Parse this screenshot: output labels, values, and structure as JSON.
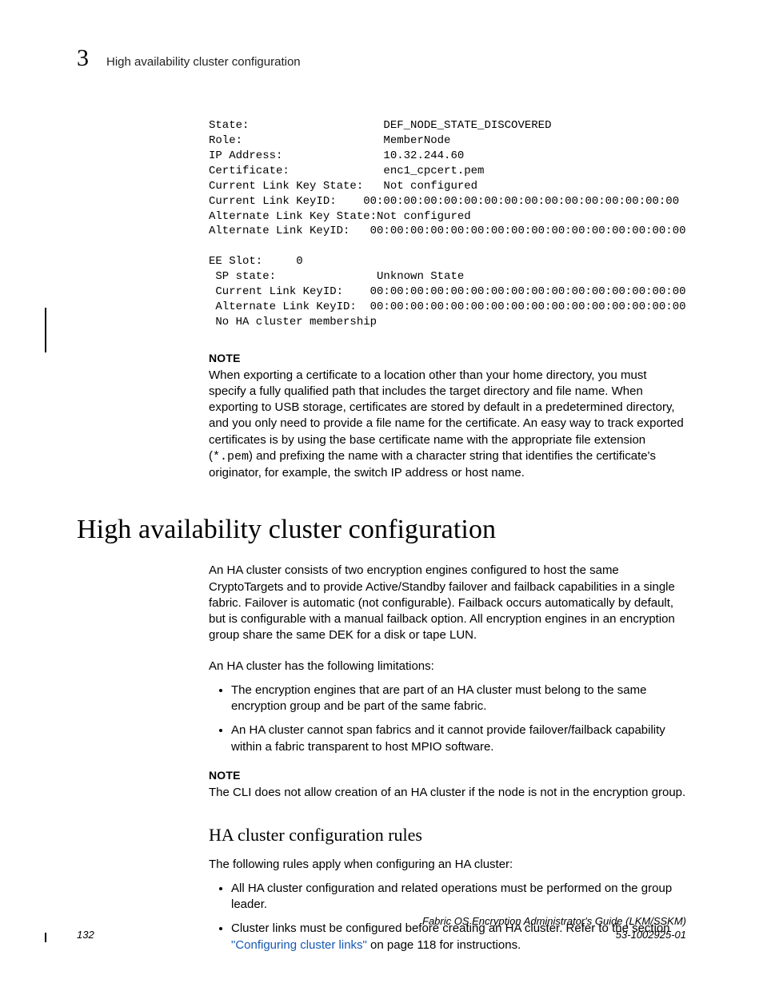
{
  "header": {
    "chapter_number": "3",
    "chapter_title": "High availability cluster configuration"
  },
  "cli_block": "State:                    DEF_NODE_STATE_DISCOVERED\nRole:                     MemberNode\nIP Address:               10.32.244.60\nCertificate:              enc1_cpcert.pem\nCurrent Link Key State:   Not configured\nCurrent Link KeyID:    00:00:00:00:00:00:00:00:00:00:00:00:00:00:00:00\nAlternate Link Key State:Not configured\nAlternate Link KeyID:   00:00:00:00:00:00:00:00:00:00:00:00:00:00:00:00\n\nEE Slot:     0\n SP state:               Unknown State\n Current Link KeyID:    00:00:00:00:00:00:00:00:00:00:00:00:00:00:00:00\n Alternate Link KeyID:  00:00:00:00:00:00:00:00:00:00:00:00:00:00:00:00\n No HA cluster membership",
  "note1": {
    "label": "NOTE",
    "text_before": "When exporting a certificate to a location other than your home directory, you must specify a fully qualified path that includes the target directory and file name. When exporting to USB storage, certificates are stored by default in a predetermined directory, and you only need to provide a file name for the certificate. An easy way to track exported certificates is by using the base certificate name with the appropriate file extension (",
    "mono": "*.pem",
    "text_after": ") and prefixing the name with a character string that identifies the certificate's originator, for example, the switch IP address or host name."
  },
  "section": {
    "title": "High availability cluster configuration",
    "para1": "An HA cluster consists of two encryption engines configured to host the same CryptoTargets and to provide Active/Standby failover and failback capabilities in a single fabric. Failover is automatic (not configurable). Failback occurs automatically by default, but is configurable with a manual failback option. All encryption engines in an encryption group share the same DEK for a disk or tape LUN.",
    "para2": "An HA cluster has the following limitations:",
    "bullets": [
      "The encryption engines that are part of an HA cluster must belong to the same encryption group and be part of the same fabric.",
      "An HA cluster cannot span fabrics and it cannot provide failover/failback capability within a fabric transparent to host MPIO software."
    ],
    "note2": {
      "label": "NOTE",
      "text": "The CLI does not allow creation of an HA cluster if the node is not in the encryption group."
    },
    "subsection": {
      "title": "HA cluster configuration rules",
      "intro": "The following rules apply when configuring an HA cluster:",
      "bullets": [
        {
          "text": "All HA cluster configuration and related operations must be performed on the group leader."
        },
        {
          "text_before": "Cluster links must be configured before creating an HA cluster. Refer to the section ",
          "xref": "\"Configuring cluster links\"",
          "text_after": " on page 118 for instructions."
        }
      ]
    }
  },
  "footer": {
    "page": "132",
    "book": "Fabric OS Encryption Administrator's Guide  (LKM/SSKM)",
    "docnum": "53-1002925-01"
  }
}
